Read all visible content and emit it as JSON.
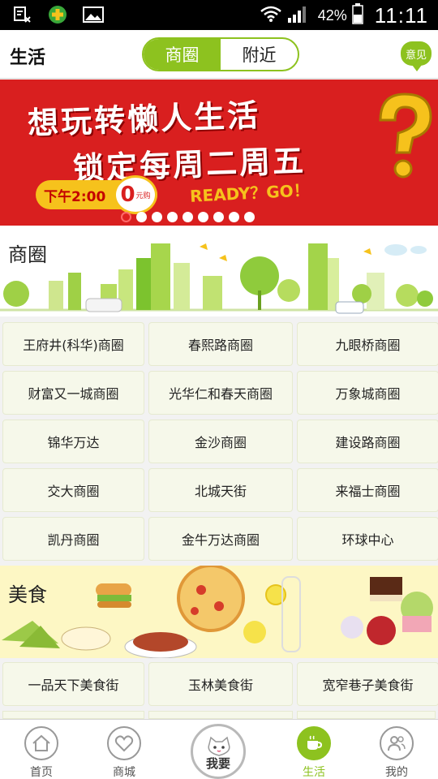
{
  "status_bar": {
    "battery_percent": "42%",
    "time": "11:11"
  },
  "header": {
    "title": "生活",
    "tabs": [
      {
        "label": "商圈",
        "active": true
      },
      {
        "label": "附近",
        "active": false
      }
    ],
    "feedback_label": "意见"
  },
  "banner": {
    "line1": "想玩转懒人生活",
    "line2": "锁定每周二周五",
    "time_text": "下午2:00",
    "zero_text": "0",
    "zero_unit": "元购",
    "go_text": "READY？GO！",
    "slide_count": 9,
    "active_slide": 1
  },
  "business_section": {
    "title": "商圈",
    "items": [
      "王府井(科华)商圈",
      "春熙路商圈",
      "九眼桥商圈",
      "财富又一城商圈",
      "光华仁和春天商圈",
      "万象城商圈",
      "锦华万达",
      "金沙商圈",
      "建设路商圈",
      "交大商圈",
      "北城天街",
      "来福士商圈",
      "凯丹商圈",
      "金牛万达商圈",
      "环球中心"
    ]
  },
  "food_section": {
    "title": "美食",
    "items": [
      "一品天下美食街",
      "玉林美食街",
      "宽窄巷子美食街"
    ]
  },
  "tabbar": {
    "items": [
      {
        "label": "首页",
        "icon": "home-icon"
      },
      {
        "label": "商城",
        "icon": "heart-icon"
      },
      {
        "label": "我要",
        "icon": "cat-icon"
      },
      {
        "label": "生活",
        "icon": "cup-icon",
        "active": true
      },
      {
        "label": "我的",
        "icon": "users-icon"
      }
    ]
  },
  "colors": {
    "accent": "#8dc21f",
    "banner_red": "#d91f1f",
    "banner_yellow": "#f6c21c",
    "cell_bg": "#f6f8ea",
    "food_bg": "#fdf7c4"
  }
}
